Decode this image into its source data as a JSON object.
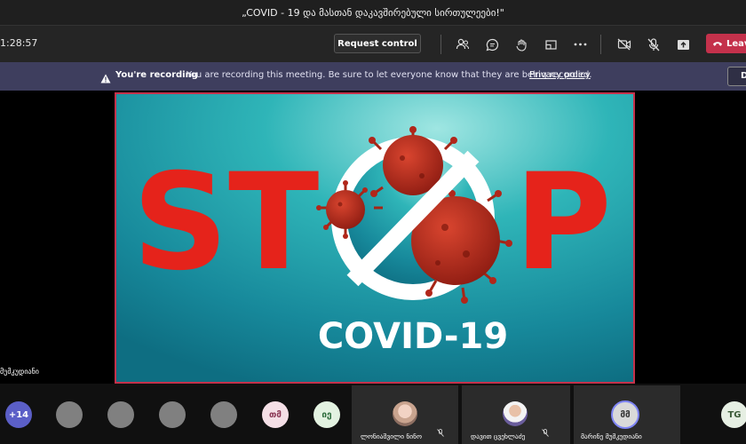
{
  "window": {
    "title": "„COVID - 19 და მასთან დაკავშირებული სირთულეები!\""
  },
  "toolbar": {
    "timer": "1:28:57",
    "request_control_label": "Request control",
    "leave_label": "Leave",
    "icons": [
      "people-icon",
      "chat-icon",
      "raise-hand-icon",
      "rooms-icon",
      "more-options-icon",
      "camera-off-icon",
      "mic-off-icon",
      "share-tray-icon",
      "phone-hangup-icon"
    ]
  },
  "recording_banner": {
    "title": "You're recording",
    "message": "You are recording this meeting. Be sure to let everyone know that they are being recorded.",
    "link": "Privacy policy",
    "dismiss_label": "Dismiss"
  },
  "shared_screen": {
    "stop_text": "ST",
    "stop_text_end": "P",
    "subtitle": "COVID-19",
    "colors": {
      "bg": "#1b8fa0",
      "red": "#e5231b",
      "virus": "#b1261a",
      "white": "#ffffff"
    }
  },
  "presenter_label": "მუმკუდიანი",
  "participants": {
    "overflow_count": "+14",
    "initials": [
      {
        "text": "თმ",
        "color": "#f4dfe6",
        "fg": "#8a3654"
      },
      {
        "text": "იე",
        "color": "#e3f2e1",
        "fg": "#2b6b3a"
      }
    ],
    "tiles": [
      {
        "name": "ლონიაშვილი ნინო"
      },
      {
        "name": "დავით ცვეხლაძე"
      },
      {
        "name": "მარინე მუმკუდიანი",
        "initials": "მმ"
      }
    ],
    "last_initials": "TG"
  }
}
